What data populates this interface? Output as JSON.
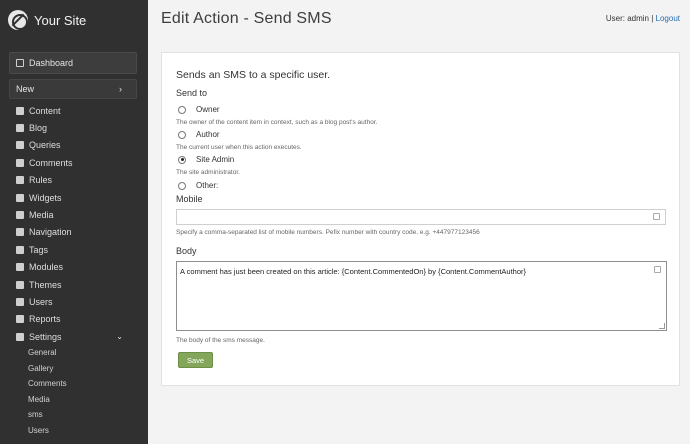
{
  "brand": {
    "name": "Your Site"
  },
  "sidebar": {
    "dashboard": "Dashboard",
    "new": "New",
    "items": [
      {
        "label": "Content"
      },
      {
        "label": "Blog"
      },
      {
        "label": "Queries"
      },
      {
        "label": "Comments"
      },
      {
        "label": "Rules"
      },
      {
        "label": "Widgets"
      },
      {
        "label": "Media"
      },
      {
        "label": "Navigation"
      },
      {
        "label": "Tags"
      },
      {
        "label": "Modules"
      },
      {
        "label": "Themes"
      },
      {
        "label": "Users"
      },
      {
        "label": "Reports"
      },
      {
        "label": "Settings"
      }
    ],
    "settings_sub": [
      {
        "label": "General"
      },
      {
        "label": "Gallery"
      },
      {
        "label": "Comments"
      },
      {
        "label": "Media"
      },
      {
        "label": "sms"
      },
      {
        "label": "Users"
      }
    ]
  },
  "header": {
    "title": "Edit Action - Send SMS",
    "user_label": "User: admin",
    "separator": "|",
    "logout": "Logout"
  },
  "form": {
    "description": "Sends an SMS to a specific user.",
    "send_to_label": "Send to",
    "options": [
      {
        "label": "Owner",
        "hint": "The owner of the content item in context, such as a blog post's author.",
        "checked": false
      },
      {
        "label": "Author",
        "hint": "The current user when this action executes.",
        "checked": false
      },
      {
        "label": "Site Admin",
        "hint": "The site administrator.",
        "checked": true
      },
      {
        "label": "Other:",
        "hint": "",
        "checked": false
      }
    ],
    "mobile_label": "Mobile",
    "mobile_value": "",
    "mobile_hint": "Specify a comma-separated list of mobile numbers. Pefix number with country code. e.g. +447977123456",
    "body_label": "Body",
    "body_value": "A comment has just been created on this article: {Content.CommentedOn} by {Content.CommentAuthor}",
    "body_hint": "The body of the sms message.",
    "save_label": "Save"
  },
  "colors": {
    "sidebar_bg": "#303030",
    "save_button": "#84a65a",
    "link": "#2a6db0"
  }
}
